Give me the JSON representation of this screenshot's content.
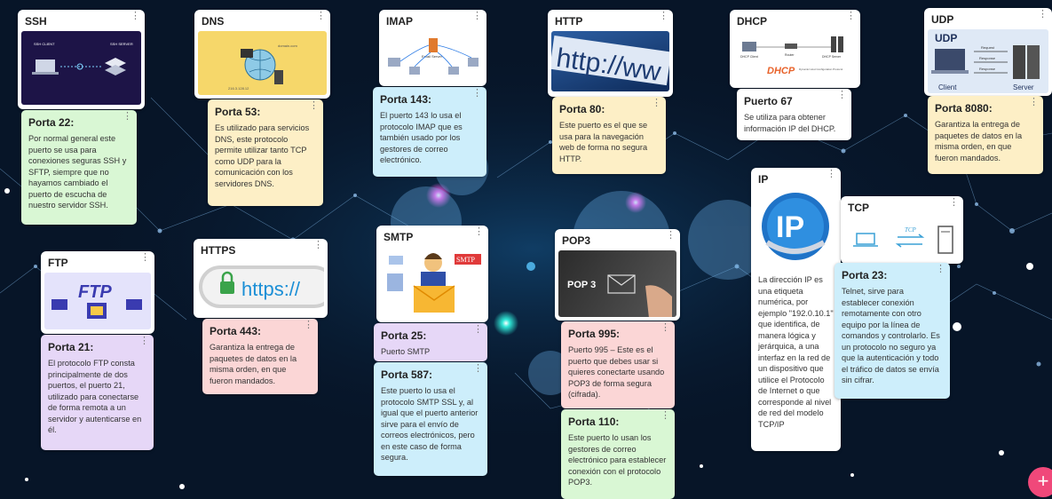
{
  "cards": {
    "ssh": {
      "title": "SSH",
      "img_labels": [
        "SSH CLIENT",
        "SSH SERVER"
      ]
    },
    "dns": {
      "title": "DNS",
      "img_labels": [
        "domain.com",
        "216.3.128.12"
      ]
    },
    "imap": {
      "title": "IMAP",
      "img_labels": [
        "Email Server"
      ]
    },
    "http": {
      "title": "HTTP",
      "img_text": "http://ww"
    },
    "dhcp": {
      "title": "DHCP",
      "img_labels": [
        "DHCP",
        "Dynamic Host Configuration Protocol",
        "DHCP Client",
        "DHCP Server",
        "Router"
      ]
    },
    "udp": {
      "title": "UDP",
      "img_labels": [
        "UDP",
        "Request",
        "Response",
        "Response",
        "Client",
        "Server"
      ]
    },
    "ftp": {
      "title": "FTP",
      "img_text": "FTP"
    },
    "https": {
      "title": "HTTPS",
      "img_text": "https://"
    },
    "smtp": {
      "title": "SMTP",
      "img_text": "SMTP"
    },
    "pop3": {
      "title": "POP3",
      "img_text": "POP 3"
    },
    "ip": {
      "title": "IP",
      "img_text": "IP"
    },
    "tcp": {
      "title": "TCP",
      "img_text": "TCP"
    }
  },
  "notes": {
    "ssh": {
      "heading": "Porta 22:",
      "text": "Por normal general este puerto se usa para conexiones seguras SSH y SFTP, siempre que no hayamos cambiado el puerto de escucha de nuestro servidor SSH."
    },
    "dns": {
      "heading": "Porta 53:",
      "text": "Es utilizado para servicios DNS, este protocolo permite utilizar tanto TCP como UDP para la comunicación con los servidores DNS."
    },
    "imap": {
      "heading": "Porta 143:",
      "text": "El puerto 143 lo usa el protocolo IMAP que es también usado por los gestores de correo electrónico."
    },
    "http": {
      "heading": "Porta 80:",
      "text": "Este puerto es el que se usa para la navegación web de forma no segura HTTP."
    },
    "dhcp": {
      "heading": "Puerto 67",
      "text": "Se utiliza para obtener información IP del DHCP."
    },
    "udp": {
      "heading": "Porta 8080:",
      "text": "Garantiza la entrega de paquetes de datos en la misma orden, en que fueron mandados."
    },
    "ftp": {
      "heading": "Porta 21:",
      "text": "El protocolo FTP consta principalmente de dos puertos, el puerto 21, utilizado para conectarse de forma remota a un servidor y autenticarse en él."
    },
    "https": {
      "heading": "Porta 443:",
      "text": "Garantiza la entrega de paquetes de datos en la misma orden, en que fueron mandados."
    },
    "smtp25": {
      "heading": "Porta 25:",
      "text": "Puerto SMTP"
    },
    "smtp587": {
      "heading": "Porta 587:",
      "text": "Este puerto lo usa el protocolo SMTP SSL y, al igual que el puerto anterior sirve para el envío de correos electrónicos, pero en este caso de forma segura."
    },
    "pop3_995": {
      "heading": "Porta 995:",
      "text": "Puerto 995 – Este es el puerto que debes usar si quieres conectarte usando POP3 de forma segura (cifrada)."
    },
    "pop3_110": {
      "heading": "Porta 110:",
      "text": "Este puerto lo usan los gestores de correo electrónico para establecer conexión con el protocolo POP3."
    },
    "ip": {
      "heading": "",
      "text": "La dirección IP es una etiqueta numérica, por ejemplo \"192.0.10.1\" que identifica, de manera lógica y jerárquica, a una interfaz en la red de un dispositivo que utilice el Protocolo de Internet o que corresponde al nivel de red del modelo TCP/IP"
    },
    "tcp": {
      "heading": "Porta 23:",
      "text": "Telnet, sirve para establecer conexión remotamente con otro equipo por la línea de comandos y controlarlo. Es un protocolo no seguro ya que la autenticación y todo el tráfico de datos se envía sin cifrar."
    }
  },
  "fab": {
    "label": "+"
  },
  "colors": {
    "background": "#071528",
    "green": "#d9f7d4",
    "yellow": "#fdefc6",
    "blue": "#cdeefb",
    "purple": "#e6d7f7",
    "pink": "#fbd6d6",
    "fab": "#f0487a"
  }
}
